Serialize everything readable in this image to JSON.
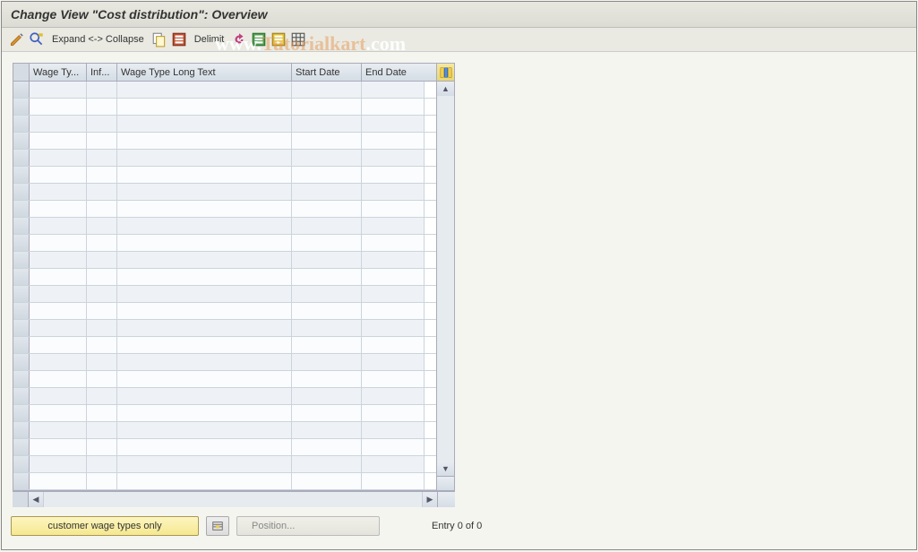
{
  "header": {
    "title": "Change View \"Cost distribution\": Overview"
  },
  "toolbar": {
    "expand": "Expand <-> Collapse",
    "delimit": "Delimit"
  },
  "watermark": {
    "part1": "www.",
    "part2": "Tutorialkart",
    "part3": ".com"
  },
  "table": {
    "columns": {
      "c1": "Wage Ty...",
      "c2": "Inf...",
      "c3": "Wage Type Long Text",
      "c4": "Start Date",
      "c5": "End Date"
    },
    "row_count": 24
  },
  "footer": {
    "customer_button": "customer wage types only",
    "position_button": "Position...",
    "entry_label": "Entry 0 of 0"
  }
}
